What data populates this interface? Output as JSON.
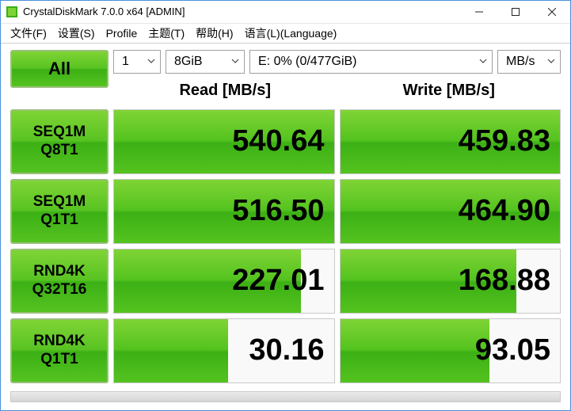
{
  "titlebar": {
    "title": "CrystalDiskMark 7.0.0 x64 [ADMIN]"
  },
  "menu": {
    "file": "文件(F)",
    "settings": "设置(S)",
    "profile": "Profile",
    "theme": "主题(T)",
    "help": "帮助(H)",
    "language": "语言(L)(Language)"
  },
  "toolbar": {
    "all_label": "All",
    "count": "1",
    "size": "8GiB",
    "drive": "E: 0% (0/477GiB)",
    "unit": "MB/s"
  },
  "headers": {
    "read": "Read [MB/s]",
    "write": "Write [MB/s]"
  },
  "rows": [
    {
      "label_line1": "SEQ1M",
      "label_line2": "Q8T1",
      "read": "540.64",
      "write": "459.83",
      "read_pct": 100,
      "write_pct": 100
    },
    {
      "label_line1": "SEQ1M",
      "label_line2": "Q1T1",
      "read": "516.50",
      "write": "464.90",
      "read_pct": 100,
      "write_pct": 100
    },
    {
      "label_line1": "RND4K",
      "label_line2": "Q32T16",
      "read": "227.01",
      "write": "168.88",
      "read_pct": 85,
      "write_pct": 80
    },
    {
      "label_line1": "RND4K",
      "label_line2": "Q1T1",
      "read": "30.16",
      "write": "93.05",
      "read_pct": 52,
      "write_pct": 68
    }
  ],
  "colors": {
    "accent": "#54c31f"
  }
}
